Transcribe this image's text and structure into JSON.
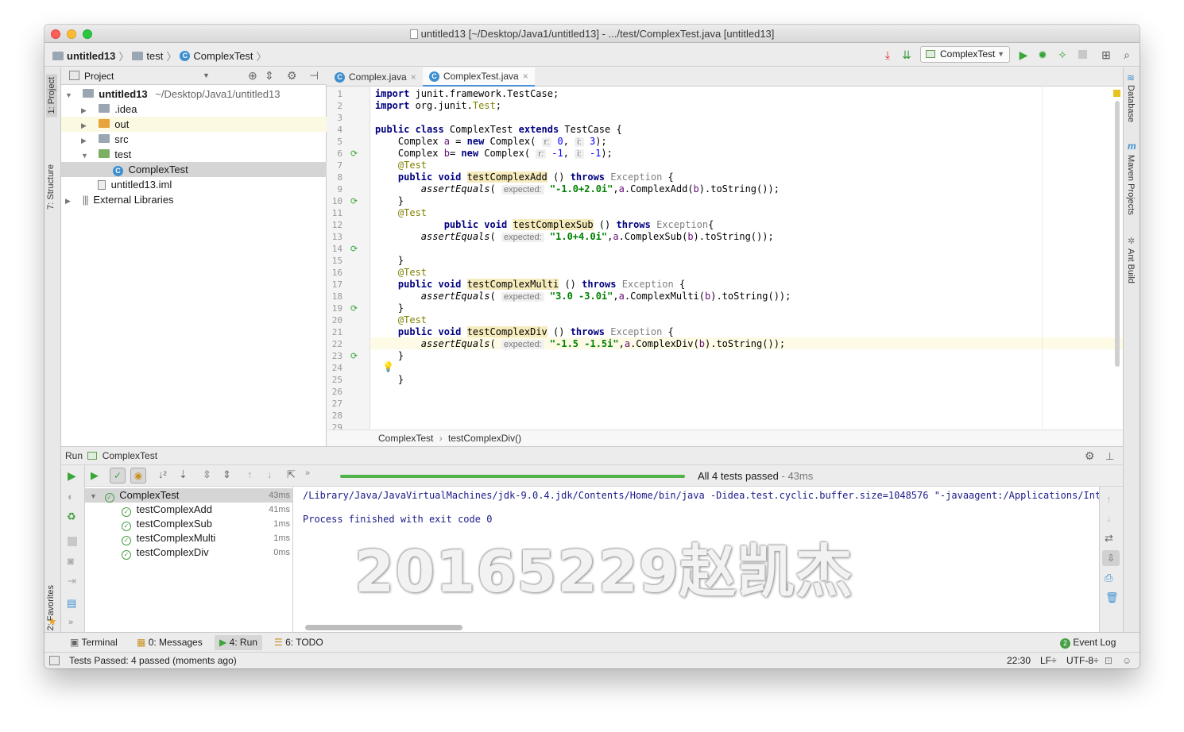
{
  "window": {
    "title": "untitled13 [~/Desktop/Java1/untitled13] - .../test/ComplexTest.java [untitled13]"
  },
  "navbar": {
    "crumbs": [
      "untitled13",
      "test",
      "ComplexTest"
    ],
    "run_config": "ComplexTest"
  },
  "left_strip": {
    "project_tab": "1: Project",
    "structure_tab": "7: Structure",
    "favorites_tab": "2: Favorites"
  },
  "right_strip": {
    "database_tab": "Database",
    "maven_tab": "Maven Projects",
    "ant_tab": "Ant Build"
  },
  "project_panel": {
    "header": "Project",
    "tree": [
      {
        "label": "untitled13",
        "detail": "~/Desktop/Java1/untitled13"
      },
      {
        "label": ".idea"
      },
      {
        "label": "out"
      },
      {
        "label": "src"
      },
      {
        "label": "test"
      },
      {
        "label": "ComplexTest"
      },
      {
        "label": "untitled13.iml"
      },
      {
        "label": "External Libraries"
      }
    ]
  },
  "editor": {
    "tabs": [
      "Complex.java",
      "ComplexTest.java"
    ],
    "line_numbers": [
      "1",
      "2",
      "3",
      "4",
      "5",
      "6",
      "7",
      "8",
      "9",
      "10",
      "11",
      "12",
      "13",
      "14",
      "15",
      "16",
      "17",
      "18",
      "19",
      "20",
      "21",
      "22",
      "23",
      "24",
      "25",
      "26",
      "27",
      "28",
      "29"
    ],
    "breadcrumb": [
      "ComplexTest",
      "testComplexDiv()"
    ],
    "hints": {
      "r": "r:",
      "i": "i:",
      "expected": "expected:"
    }
  },
  "run_panel": {
    "header_prefix": "Run",
    "header_config": "ComplexTest",
    "status": "All 4 tests passed",
    "status_time": "- 43ms",
    "tests": [
      {
        "name": "ComplexTest",
        "duration": "43ms"
      },
      {
        "name": "testComplexAdd",
        "duration": "41ms"
      },
      {
        "name": "testComplexSub",
        "duration": "1ms"
      },
      {
        "name": "testComplexMulti",
        "duration": "1ms"
      },
      {
        "name": "testComplexDiv",
        "duration": "0ms"
      }
    ],
    "console": [
      "/Library/Java/JavaVirtualMachines/jdk-9.0.4.jdk/Contents/Home/bin/java -Didea.test.cyclic.buffer.size=1048576 \"-javaagent:/Applications/Intelli",
      "Process finished with exit code 0"
    ],
    "watermark": "20165229赵凯杰"
  },
  "bottom_tabs": [
    "Terminal",
    "0: Messages",
    "4: Run",
    "6: TODO"
  ],
  "event_log": {
    "count": "2",
    "label": "Event Log"
  },
  "statusbar": {
    "message": "Tests Passed: 4 passed (moments ago)",
    "position": "22:30",
    "line_sep": "LF÷",
    "encoding": "UTF-8÷"
  },
  "colors": {
    "accent": "#4a90d9",
    "pass": "#45a045",
    "progress": "#4fb34a"
  }
}
